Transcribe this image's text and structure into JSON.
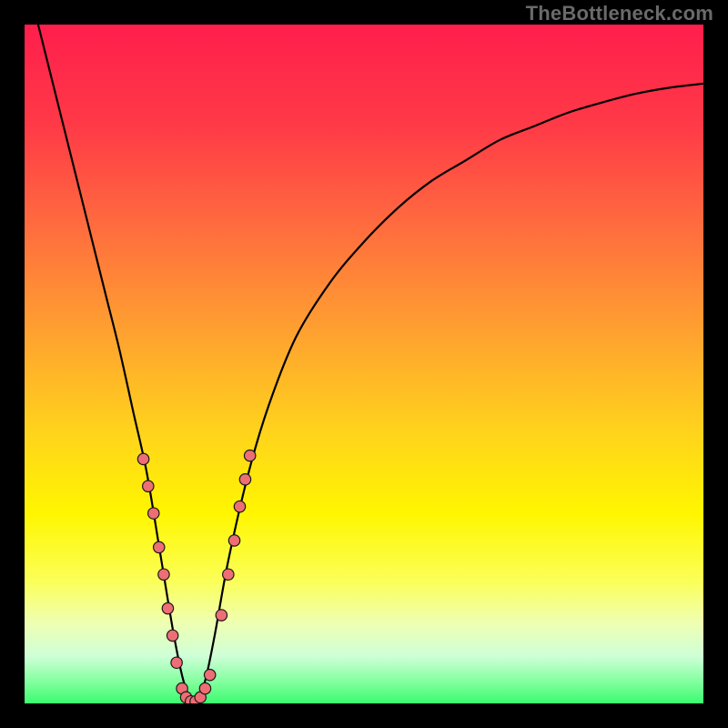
{
  "watermark": "TheBottleneck.com",
  "layout": {
    "plot_background_left": 27,
    "plot_background_top": 27,
    "plot_background_width": 746,
    "plot_background_height": 746,
    "svg_viewbox_width": 746,
    "svg_viewbox_height": 746
  },
  "colors": {
    "frame": "#000000",
    "gradient_stops": [
      {
        "offset": 0.0,
        "color": "#ff1e4c"
      },
      {
        "offset": 0.15,
        "color": "#ff3a47"
      },
      {
        "offset": 0.3,
        "color": "#ff6d3e"
      },
      {
        "offset": 0.45,
        "color": "#ffa030"
      },
      {
        "offset": 0.6,
        "color": "#ffd31c"
      },
      {
        "offset": 0.72,
        "color": "#fff600"
      },
      {
        "offset": 0.82,
        "color": "#fbff58"
      },
      {
        "offset": 0.88,
        "color": "#efffb1"
      },
      {
        "offset": 0.93,
        "color": "#cfffd7"
      },
      {
        "offset": 0.97,
        "color": "#7eff9c"
      },
      {
        "offset": 1.0,
        "color": "#3bfb70"
      }
    ],
    "curve_stroke": "#000000",
    "dot_fill": "#ee6e75",
    "dot_stroke": "#1a1a1a"
  },
  "chart_data": {
    "type": "line",
    "title": "",
    "xlabel": "",
    "ylabel": "",
    "xlim": [
      0,
      100
    ],
    "ylim": [
      0,
      100
    ],
    "grid": false,
    "legend": false,
    "series": [
      {
        "name": "bottleneck-curve",
        "x": [
          2,
          4,
          6,
          8,
          10,
          12,
          14,
          16,
          18,
          20,
          22,
          23.5,
          25,
          26.5,
          28,
          30,
          33,
          36,
          40,
          45,
          50,
          55,
          60,
          65,
          70,
          75,
          80,
          85,
          90,
          95,
          100
        ],
        "values": [
          100,
          92,
          84,
          76,
          68,
          60,
          52,
          43,
          34,
          22,
          10,
          3,
          0,
          3,
          10,
          21,
          34,
          44,
          54,
          62,
          68,
          73,
          77,
          80,
          83,
          85,
          87,
          88.5,
          89.8,
          90.7,
          91.3
        ]
      }
    ],
    "markers": [
      {
        "name": "left-cluster",
        "series": "bottleneck-curve",
        "x": [
          17.5,
          18.2,
          19.0,
          19.8,
          20.5,
          21.1,
          21.8,
          22.4
        ],
        "values": [
          36.0,
          32.0,
          28.0,
          23.0,
          19.0,
          14.0,
          10.0,
          6.0
        ]
      },
      {
        "name": "valley-floor",
        "series": "bottleneck-curve",
        "x": [
          23.2,
          23.8,
          24.5,
          25.2,
          25.9,
          26.6,
          27.3
        ],
        "values": [
          2.2,
          0.9,
          0.3,
          0.3,
          0.9,
          2.2,
          4.2
        ]
      },
      {
        "name": "right-cluster",
        "series": "bottleneck-curve",
        "x": [
          29.0,
          30.0,
          30.9,
          31.7,
          32.5,
          33.2
        ],
        "values": [
          13.0,
          19.0,
          24.0,
          29.0,
          33.0,
          36.5
        ]
      }
    ]
  }
}
